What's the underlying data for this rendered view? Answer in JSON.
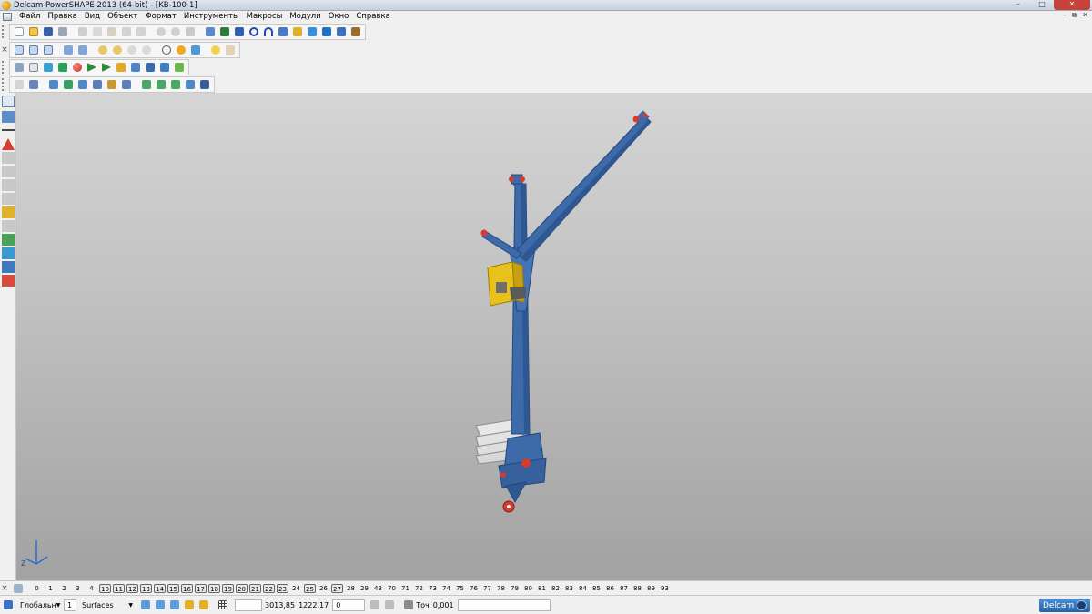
{
  "window": {
    "title": "Delcam PowerSHAPE 2013 (64-bit) - [KB-100-1]"
  },
  "menu": {
    "items": [
      "Файл",
      "Правка",
      "Вид",
      "Объект",
      "Формат",
      "Инструменты",
      "Макросы",
      "Модули",
      "Окно",
      "Справка"
    ]
  },
  "layers": {
    "numbers": [
      "0",
      "1",
      "2",
      "3",
      "4",
      "10",
      "11",
      "12",
      "13",
      "14",
      "15",
      "16",
      "17",
      "18",
      "19",
      "20",
      "21",
      "22",
      "23",
      "24",
      "25",
      "26",
      "27",
      "28",
      "29",
      "43",
      "70",
      "71",
      "72",
      "73",
      "74",
      "75",
      "76",
      "77",
      "78",
      "79",
      "80",
      "81",
      "82",
      "83",
      "84",
      "85",
      "86",
      "87",
      "88",
      "89",
      "93"
    ],
    "boxed": [
      "10",
      "11",
      "12",
      "13",
      "14",
      "15",
      "16",
      "17",
      "18",
      "19",
      "20",
      "21",
      "22",
      "23",
      "25",
      "27"
    ]
  },
  "status": {
    "workplane": "Глобальн",
    "level_value": "1",
    "level_name": "Surfaces",
    "coord_x": "3013,85",
    "coord_y": "1222,17",
    "coord_z": "0",
    "tolerance_label": "Точ",
    "tolerance_value": "0,001"
  },
  "branding": {
    "logo_text": "Delcam"
  },
  "axis": {
    "z_label": "Z"
  },
  "colors": {
    "crane_blue": "#3d6aa8",
    "crane_dark": "#2a4d82",
    "accent_red": "#d93a2b",
    "cabin_yellow": "#e8c21a"
  },
  "icons": {
    "top_row": [
      "new-icon",
      "open-icon",
      "save-icon",
      "print-icon",
      "cut-icon",
      "copy-icon",
      "paste-icon",
      "undo-icon",
      "redo-icon",
      "select-icon",
      "circle-icon",
      "arc-icon",
      "surface-icon"
    ],
    "second_row": [
      "view-top-icon",
      "view-front-icon",
      "view-iso-icon",
      "zoom-in-icon",
      "zoom-out-icon",
      "shade-icon",
      "light-icon"
    ],
    "third_row": [
      "layer-icon",
      "material-icon",
      "render-icon",
      "sphere-icon",
      "block-icon"
    ],
    "fourth_row": [
      "wireframe-icon",
      "box-icon",
      "cylinder-icon",
      "cone-icon",
      "solid-icon"
    ]
  }
}
